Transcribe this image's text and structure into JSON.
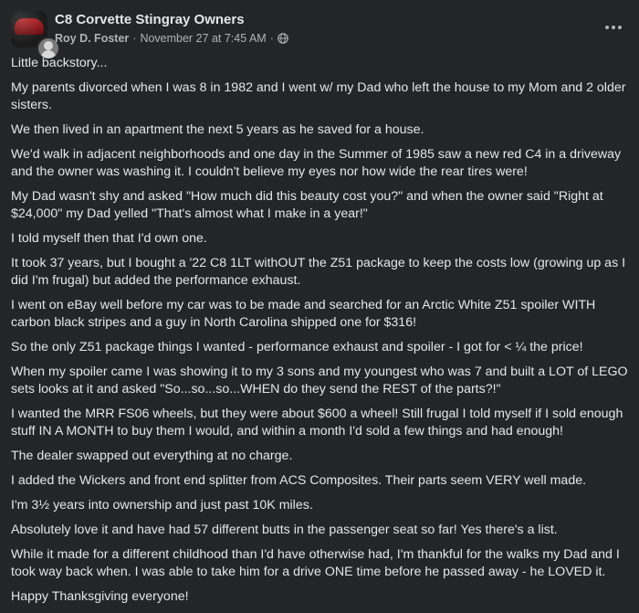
{
  "post": {
    "group_name": "C8 Corvette Stingray Owners",
    "author": "Roy D. Foster",
    "separator": "·",
    "timestamp": "November 27 at 7:45 AM",
    "separator2": "·",
    "icons": {
      "group_avatar": "corvette-group-icon",
      "user_avatar": "user-avatar-icon",
      "privacy": "globe-icon",
      "more": "more-options-icon"
    },
    "paragraphs": [
      "Little backstory...",
      "My parents divorced when I was 8 in 1982 and I went w/ my Dad who left the house to my Mom and 2 older sisters.",
      "We then lived in an apartment the next 5 years as he saved for a house.",
      "We'd walk in adjacent neighborhoods and one day in the Summer of 1985 saw a new red C4 in a driveway and the owner was washing it.  I couldn't believe my eyes nor how wide the rear tires were!",
      "My Dad wasn't shy and asked \"How much did this beauty cost you?\" and when the owner said \"Right at $24,000\" my Dad yelled \"That's almost what I make in a year!\"",
      "I told myself then that I'd own one.",
      "It took 37 years, but I bought a '22 C8 1LT withOUT the Z51 package to keep the costs low (growing up as I did I'm frugal) but added the performance exhaust.",
      "I went on eBay well before my car was to be made and searched for an Arctic White Z51 spoiler WITH carbon black stripes and a guy in North Carolina shipped one for $316!",
      "So the only Z51 package things I wanted - performance exhaust and spoiler - I got for < ¼ the price!",
      "When my spoiler came I was showing it to my 3 sons and my youngest who was 7 and built a LOT of LEGO sets looks at it and asked \"So...so...so...WHEN do they send the REST of the parts?!\"",
      "I wanted the MRR FS06 wheels, but they were about $600 a wheel!  Still frugal I told myself if I sold enough stuff IN A MONTH to buy them I would, and within a month I'd sold a few things and had enough!",
      "The dealer swapped out everything at no charge.",
      "I added the Wickers and front end splitter from ACS Composites. Their parts seem VERY well made.",
      "I'm 3½ years into ownership and just past 10K miles.",
      "Absolutely love it and have had 57 different butts in the passenger seat so far! Yes there's a list.",
      "While it made for a different childhood than I'd have otherwise had, I'm thankful for the walks my Dad and I took way back when.  I was able to take him for a drive ONE time before he passed away - he LOVED it.",
      "Happy Thanksgiving everyone!"
    ]
  }
}
